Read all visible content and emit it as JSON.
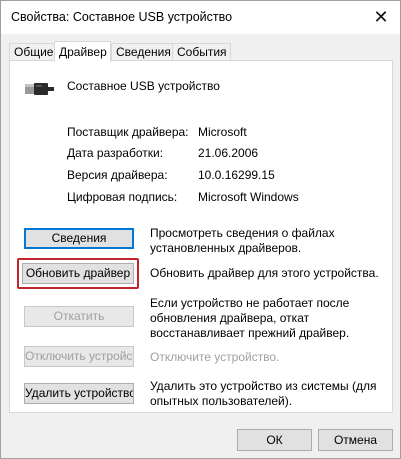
{
  "window": {
    "title": "Свойства: Составное USB устройство"
  },
  "tabs": [
    {
      "label": "Общие"
    },
    {
      "label": "Драйвер"
    },
    {
      "label": "Сведения"
    },
    {
      "label": "События"
    }
  ],
  "device": {
    "name": "Составное USB устройство",
    "icon": "usb-plug-icon"
  },
  "info": [
    {
      "label": "Поставщик драйвера:",
      "value": "Microsoft"
    },
    {
      "label": "Дата разработки:",
      "value": "21.06.2006"
    },
    {
      "label": "Версия драйвера:",
      "value": "10.0.16299.15"
    },
    {
      "label": "Цифровая подпись:",
      "value": "Microsoft Windows"
    }
  ],
  "actions": [
    {
      "button": "Сведения",
      "desc": "Просмотреть сведения о файлах установленных драйверов."
    },
    {
      "button": "Обновить драйвер",
      "desc": "Обновить драйвер для этого устройства."
    },
    {
      "button": "Откатить",
      "desc": "Если устройство не работает после обновления драйвера, откат восстанавливает прежний драйвер."
    },
    {
      "button": "Отключить устройство",
      "desc": "Отключите устройство."
    },
    {
      "button": "Удалить устройство",
      "desc": "Удалить это устройство из системы (для опытных пользователей)."
    }
  ],
  "footer": {
    "ok": "ОК",
    "cancel": "Отмена"
  },
  "colors": {
    "highlight": "#c0242f",
    "focus": "#0078d7"
  }
}
